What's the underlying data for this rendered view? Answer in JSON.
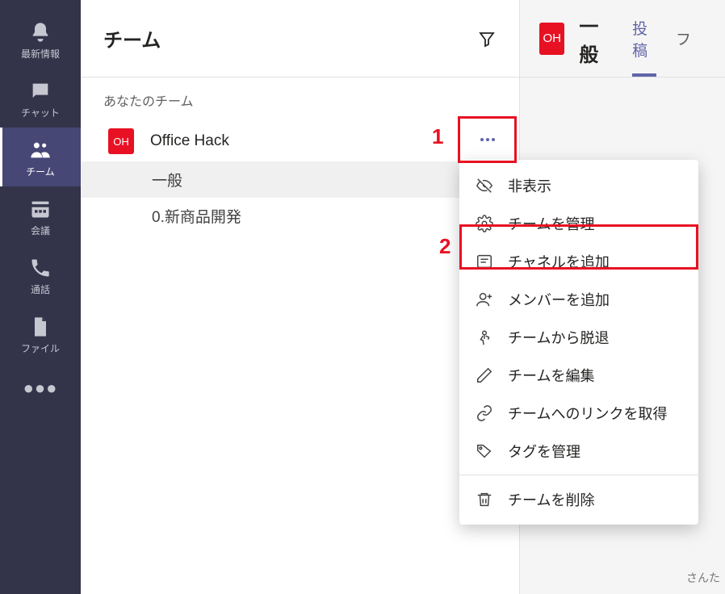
{
  "rail": {
    "items": [
      {
        "label": "最新情報",
        "icon": "bell"
      },
      {
        "label": "チャット",
        "icon": "chat"
      },
      {
        "label": "チーム",
        "icon": "teams",
        "active": true
      },
      {
        "label": "会議",
        "icon": "calendar"
      },
      {
        "label": "通話",
        "icon": "phone"
      },
      {
        "label": "ファイル",
        "icon": "file"
      }
    ]
  },
  "list": {
    "title": "チーム",
    "section_label": "あなたのチーム",
    "team": {
      "avatar_text": "OH",
      "name": "Office Hack"
    },
    "channels": [
      {
        "name": "一般"
      },
      {
        "name": "0.新商品開発"
      }
    ]
  },
  "content": {
    "avatar_text": "OH",
    "channel_title": "一般",
    "tabs": [
      {
        "label": "投稿",
        "active": true
      },
      {
        "label": "フ"
      }
    ],
    "peek_text": "さんた"
  },
  "menu": {
    "items": [
      {
        "icon": "hide",
        "label": "非表示"
      },
      {
        "icon": "gear",
        "label": "チームを管理"
      },
      {
        "icon": "channel-add",
        "label": "チャネルを追加"
      },
      {
        "icon": "person-add",
        "label": "メンバーを追加"
      },
      {
        "icon": "leave",
        "label": "チームから脱退"
      },
      {
        "icon": "edit",
        "label": "チームを編集"
      },
      {
        "icon": "link",
        "label": "チームへのリンクを取得"
      },
      {
        "icon": "tag",
        "label": "タグを管理"
      }
    ],
    "delete": {
      "icon": "trash",
      "label": "チームを削除"
    }
  },
  "annotations": {
    "n1": "1",
    "n2": "2"
  }
}
